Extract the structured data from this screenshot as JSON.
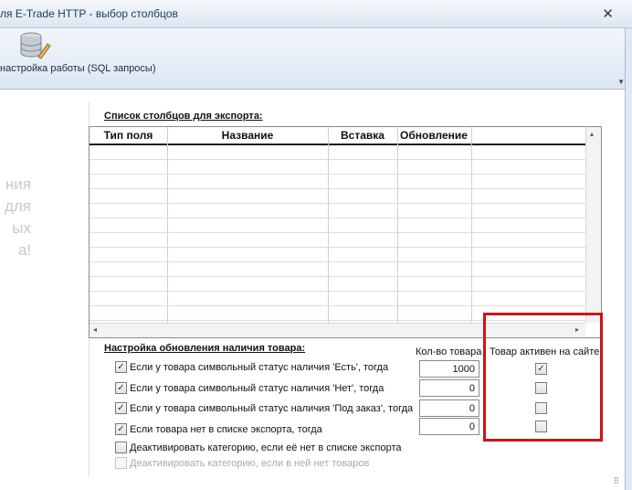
{
  "window": {
    "title": "ля E-Trade HTTP - выбор столбцов",
    "close_glyph": "✕"
  },
  "ribbon": {
    "button_label": "настройка работы (SQL запросы)",
    "icon": "database-icon",
    "dropdown_glyph": "▼"
  },
  "watermark": [
    "ния",
    "для",
    "ых",
    "а!"
  ],
  "columns_section": {
    "title": "Список столбцов для экспорта:",
    "headers": [
      "Тип поля",
      "Название",
      "Вставка",
      "Обновление"
    ],
    "scroll_left": "◂",
    "scroll_right": "▸",
    "scroll_up": "▴"
  },
  "stock_section": {
    "title": "Настройка обновления наличия товара:",
    "qty_header": "Кол-во товара",
    "active_header": "Товар активен на сайте",
    "rows": [
      {
        "label": "Если у товара символьный статус наличия 'Есть', тогда",
        "checked": true,
        "qty": "1000",
        "active": true
      },
      {
        "label": "Если у товара символьный статус наличия 'Нет', тогда",
        "checked": true,
        "qty": "0",
        "active": false
      },
      {
        "label": "Если у товара символьный статус наличия 'Под заказ', тогда",
        "checked": true,
        "qty": "0",
        "active": false
      },
      {
        "label": "Если товара нет в списке экспорта, тогда",
        "checked": true,
        "qty": "0",
        "active": false
      }
    ],
    "deactivate_category": "Деактивировать категорию, если её нет в списке экспорта",
    "deactivate_empty": "Деактивировать категорию, если в ней нет товаров",
    "check_glyph": "✓"
  },
  "colors": {
    "highlight": "#d0121b",
    "window_title": "#1e395b"
  }
}
